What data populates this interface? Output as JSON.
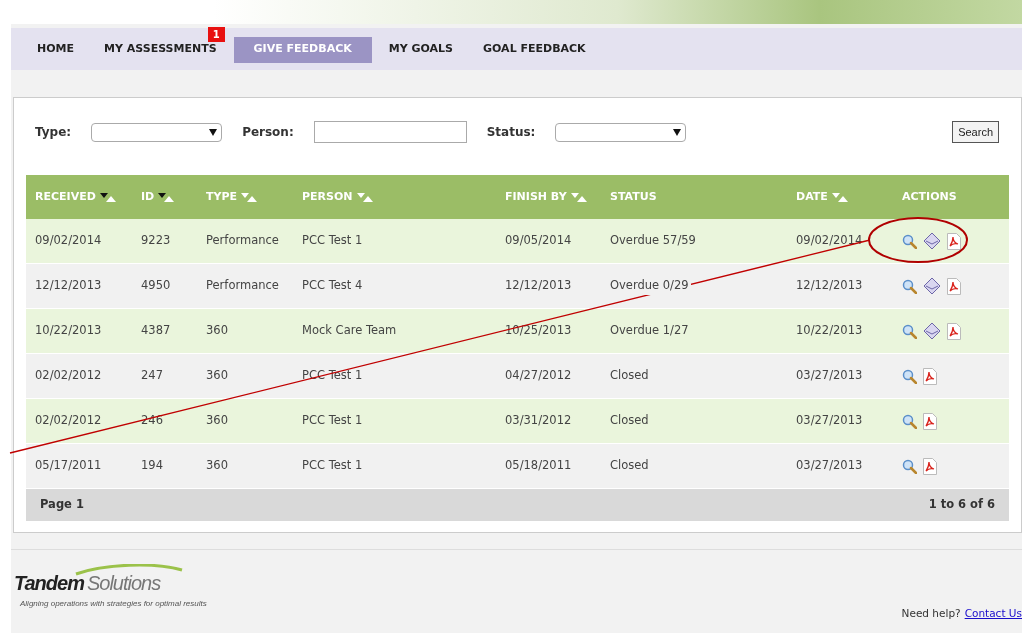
{
  "nav": [
    {
      "label": "HOME",
      "selected": false
    },
    {
      "label": "MY ASSESSMENTS",
      "selected": false,
      "badge": "1"
    },
    {
      "label": "GIVE FEEDBACK",
      "selected": true
    },
    {
      "label": "MY GOALS",
      "selected": false
    },
    {
      "label": "GOAL FEEDBACK",
      "selected": false
    }
  ],
  "filters": [
    {
      "kind": "select",
      "label": "Type:"
    },
    {
      "kind": "text",
      "label": "Person:"
    },
    {
      "kind": "select",
      "label": "Status:"
    }
  ],
  "search_button": "Search",
  "table": {
    "columns": [
      {
        "label": "RECEIVED",
        "sortable": true,
        "sorted": true
      },
      {
        "label": "ID",
        "sortable": true,
        "sorted": true
      },
      {
        "label": "TYPE",
        "sortable": true,
        "sorted": false
      },
      {
        "label": "PERSON",
        "sortable": true,
        "sorted": false
      },
      {
        "label": "FINISH BY",
        "sortable": true,
        "sorted": false
      },
      {
        "label": "STATUS",
        "sortable": false
      },
      {
        "label": "DATE",
        "sortable": true,
        "sorted": false
      },
      {
        "label": "ACTIONS",
        "sortable": false
      }
    ],
    "rows": [
      {
        "cells": [
          "09/02/2014",
          "9223",
          "Performance",
          "PCC Test 1",
          "09/05/2014",
          "Overdue 57/59",
          "09/02/2014"
        ],
        "actions": [
          {
            "kind": "view"
          },
          {
            "kind": "email"
          },
          {
            "kind": "pdf"
          }
        ]
      },
      {
        "cells": [
          "12/12/2013",
          "4950",
          "Performance",
          "PCC Test 4",
          "12/12/2013",
          "Overdue 0/29",
          "12/12/2013"
        ],
        "actions": [
          {
            "kind": "view"
          },
          {
            "kind": "email"
          },
          {
            "kind": "pdf"
          }
        ]
      },
      {
        "cells": [
          "10/22/2013",
          "4387",
          "360",
          "Mock Care Team",
          "10/25/2013",
          "Overdue 1/27",
          "10/22/2013"
        ],
        "actions": [
          {
            "kind": "view"
          },
          {
            "kind": "email"
          },
          {
            "kind": "pdf"
          }
        ]
      },
      {
        "cells": [
          "02/02/2012",
          "247",
          "360",
          "PCC Test 1",
          "04/27/2012",
          "Closed",
          "03/27/2013"
        ],
        "actions": [
          {
            "kind": "view"
          },
          {
            "kind": "pdf"
          }
        ]
      },
      {
        "cells": [
          "02/02/2012",
          "246",
          "360",
          "PCC Test 1",
          "03/31/2012",
          "Closed",
          "03/27/2013"
        ],
        "actions": [
          {
            "kind": "view"
          },
          {
            "kind": "pdf"
          }
        ]
      },
      {
        "cells": [
          "05/17/2011",
          "194",
          "360",
          "PCC Test 1",
          "05/18/2011",
          "Closed",
          "03/27/2013"
        ],
        "actions": [
          {
            "kind": "view"
          },
          {
            "kind": "pdf"
          }
        ]
      }
    ],
    "footer": {
      "page": "Page 1",
      "range": "1 to 6 of 6"
    }
  },
  "logo": {
    "name_first": "Tandem",
    "name_second": "Solutions",
    "tagline": "Aligning operations with strategies for optimal results"
  },
  "help": {
    "text": "Need help?",
    "link": "Contact Us"
  }
}
